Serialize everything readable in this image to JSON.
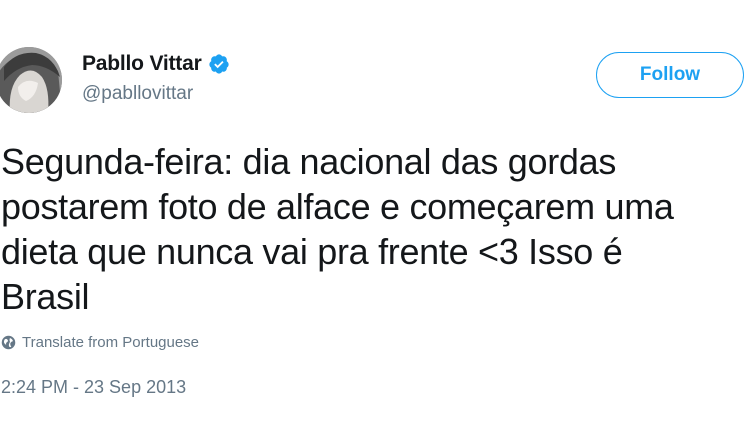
{
  "user": {
    "display_name": "Pabllo Vittar",
    "handle": "@pabllovittar",
    "verified": true,
    "avatar_icon": "user-photo"
  },
  "actions": {
    "follow_label": "Follow"
  },
  "tweet": {
    "lines": [
      "Segunda-feira: dia nacional das gordas",
      "postarem foto de alface e começarem uma",
      "dieta que nunca vai pra frente  <3 Isso é",
      "Brasil"
    ],
    "translate_label": "Translate from Portuguese",
    "translate_icon": "globe-icon",
    "timestamp": "2:24 PM - 23 Sep 2013"
  },
  "colors": {
    "accent": "#1da1f2",
    "text_primary": "#14171a",
    "text_secondary": "#657786"
  }
}
